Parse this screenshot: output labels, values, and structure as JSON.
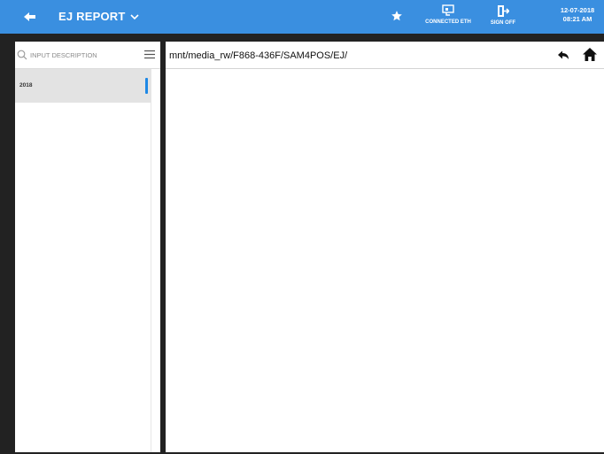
{
  "header": {
    "title": "EJ REPORT",
    "status": {
      "network_label": "CONNECTED ETH",
      "signoff_label": "SIGN OFF"
    },
    "date": "12-07-2018",
    "time": "08:21 AM",
    "colors": {
      "bar": "#3a8fe0",
      "text": "#ffffff"
    }
  },
  "sidebar": {
    "search_placeholder": "INPUT DESCRIPTION",
    "items": [
      {
        "label": "2018",
        "selected": true
      }
    ],
    "accent": "#1e88e5"
  },
  "main": {
    "path": "mnt/media_rw/F868-436F/SAM4POS/EJ/"
  },
  "icons": [
    "back-arrow-icon",
    "chevron-down-icon",
    "star-icon",
    "ethernet-monitor-icon",
    "sign-off-icon",
    "search-icon",
    "menu-icon",
    "up-level-icon",
    "home-icon"
  ]
}
